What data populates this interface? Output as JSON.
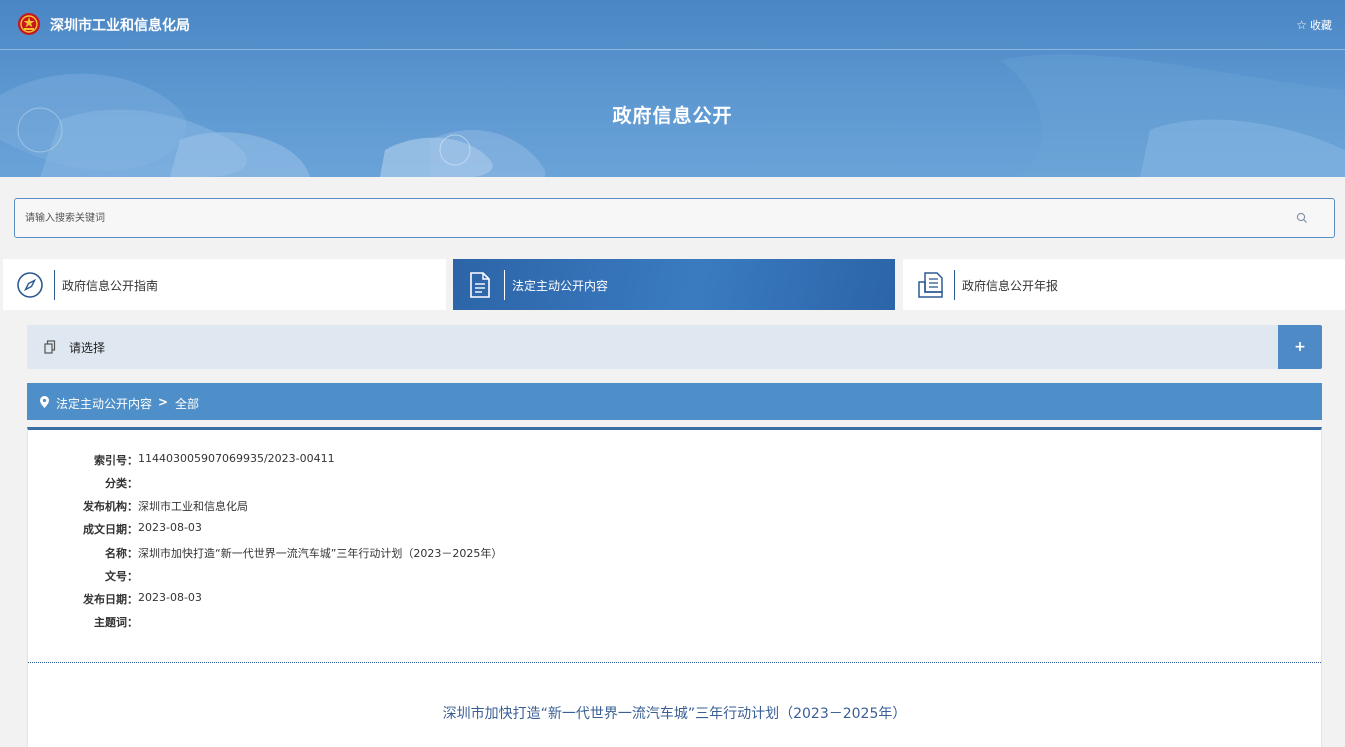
{
  "header": {
    "site_name": "深圳市工业和信息化局",
    "favorite_label": "收藏",
    "banner_title": "政府信息公开"
  },
  "search": {
    "placeholder": "请输入搜索关键词",
    "icon": "search-icon"
  },
  "tabs": [
    {
      "label": "政府信息公开指南",
      "icon": "compass-icon",
      "active": false
    },
    {
      "label": "法定主动公开内容",
      "icon": "document-icon",
      "active": true
    },
    {
      "label": "政府信息公开年报",
      "icon": "report-icon",
      "active": false
    }
  ],
  "selector": {
    "label": "请选择",
    "expand_symbol": "+"
  },
  "breadcrumb": {
    "section": "法定主动公开内容",
    "separator": ">",
    "current": "全部"
  },
  "meta": [
    {
      "key": "索引号：",
      "value": "11440300590706993​5/2023-00411"
    },
    {
      "key": "分类：",
      "value": ""
    },
    {
      "key": "发布机构：",
      "value": "深圳市工业和信息化局"
    },
    {
      "key": "成文日期：",
      "value": "2023-08-03"
    },
    {
      "key": "名称：",
      "value": "深圳市加快打造“新一代世界一流汽车城”三年行动计划（2023－2025年）"
    },
    {
      "key": "文号：",
      "value": ""
    },
    {
      "key": "发布日期：",
      "value": "2023-08-03"
    },
    {
      "key": "主题词：",
      "value": ""
    }
  ],
  "document": {
    "title": "深圳市加快打造“新一代世界一流汽车城”三年行动计划（2023－2025年）"
  },
  "colors": {
    "primary": "#4e8fc9",
    "active_tab": "#2d64a8",
    "panel_border": "#3a6ea5",
    "selector_bg": "#dfe8f0"
  }
}
